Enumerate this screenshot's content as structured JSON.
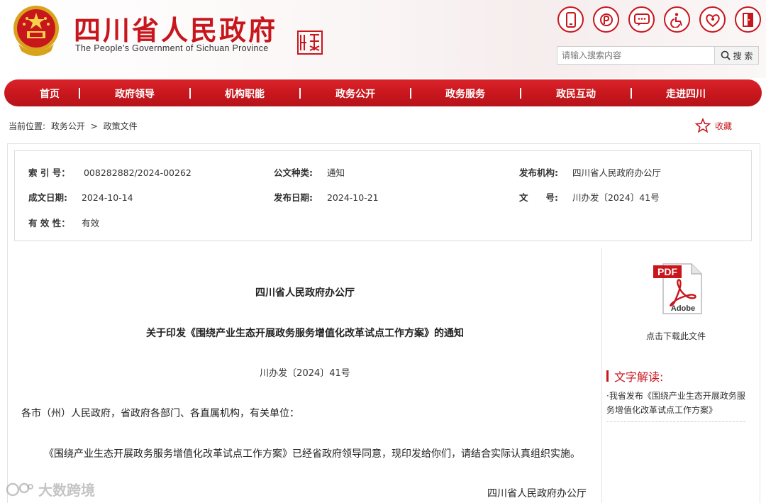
{
  "header": {
    "title": "四川省人民政府",
    "subtitle": "The People’s Government of Sichuan Province",
    "search": {
      "placeholder": "请输入搜索内容",
      "button_label": "搜 索"
    },
    "tool_icons": [
      "mobile-icon",
      "weibo-icon",
      "wechat-icon",
      "accessibility-icon",
      "elderly-care-icon",
      "exit-icon"
    ],
    "brand_color": "#c8161d"
  },
  "nav": {
    "items": [
      "首页",
      "政府领导",
      "机构职能",
      "政务公开",
      "政务服务",
      "政民互动",
      "走进四川"
    ]
  },
  "breadcrumb": {
    "prefix": "当前位置:",
    "items": [
      "政务公开",
      ">",
      "政策文件"
    ]
  },
  "favorite": {
    "label": "收藏"
  },
  "meta": {
    "index_label": "索 引 号：",
    "index_value": "008282882/2024-00262",
    "category_label": "公文种类:",
    "category_value": "通知",
    "issuer_label": "发布机构:",
    "issuer_value": "四川省人民政府办公厅",
    "created_label": "成文日期:",
    "created_value": "2024-10-14",
    "published_label": "发布日期:",
    "published_value": "2024-10-21",
    "docno_label": "文　　号:",
    "docno_value": "川办发〔2024〕41号",
    "validity_label": "有 效 性：",
    "validity_value": "有效"
  },
  "article": {
    "org": "四川省人民政府办公厅",
    "title": "关于印发《围绕产业生态开展政务服务增值化改革试点工作方案》的通知",
    "doc_number": "川办发〔2024〕41号",
    "salutation": "各市（州）人民政府，省政府各部门、各直属机构，有关单位：",
    "body": "《围绕产业生态开展政务服务增值化改革试点工作方案》已经省政府领导同意，现印发给你们，请结合实际认真组织实施。",
    "signature": "四川省人民政府办公厅"
  },
  "sidebar": {
    "download_label": "点击下载此文件",
    "pdf_badge": "PDF",
    "pdf_brand": "Adobe",
    "interpretation_heading": "文字解读:",
    "interpretation_link": "·我省发布《围绕产业生态开展政务服务增值化改革试点工作方案》"
  },
  "watermark": {
    "text": "大数跨境"
  }
}
